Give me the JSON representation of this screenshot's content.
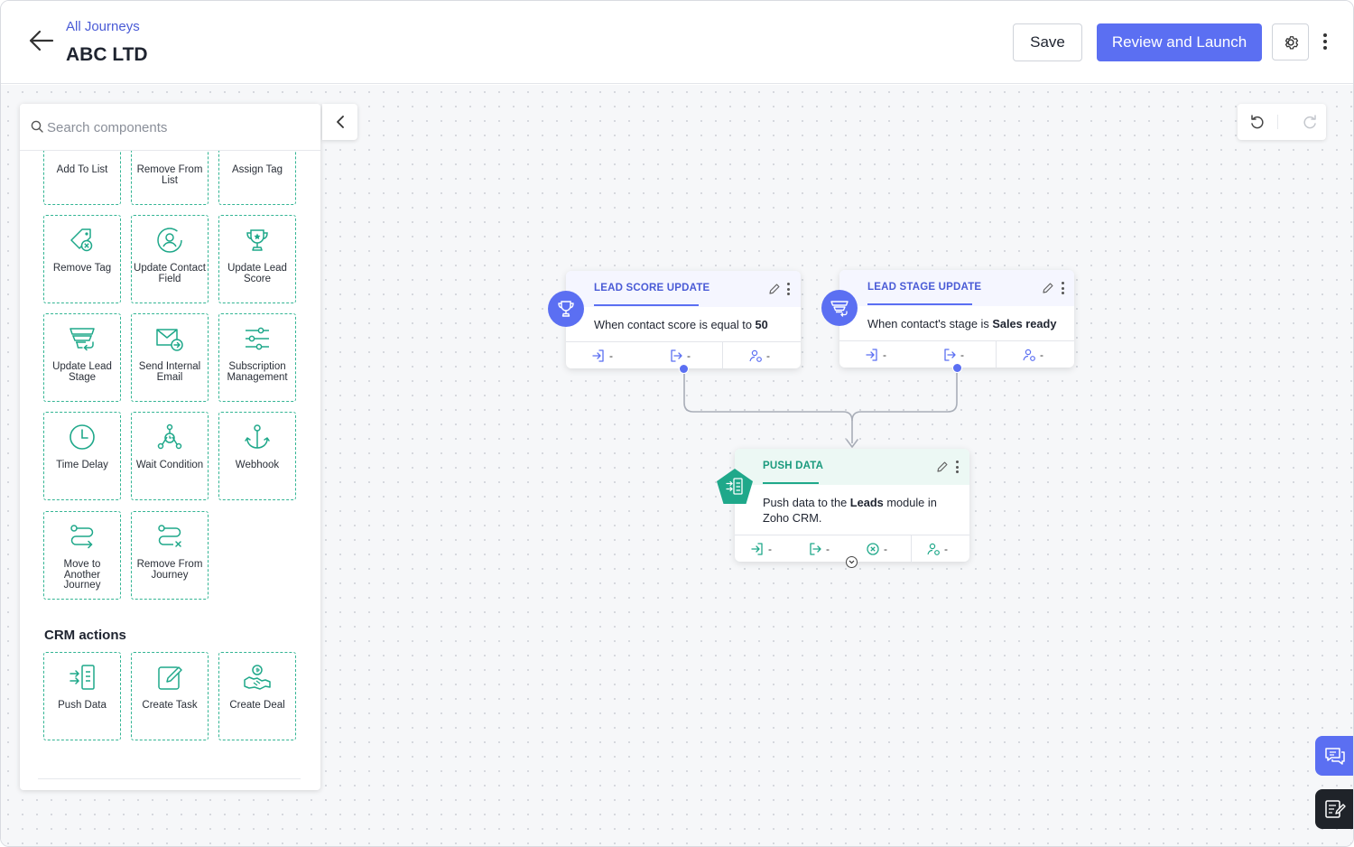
{
  "header": {
    "breadcrumb": "All Journeys",
    "title": "ABC LTD",
    "save_label": "Save",
    "launch_label": "Review and Launch"
  },
  "panel": {
    "search_placeholder": "Search components",
    "tiles": [
      {
        "label": "Add To List",
        "icon": "add-to-list-icon"
      },
      {
        "label": "Remove From List",
        "icon": "remove-from-list-icon"
      },
      {
        "label": "Assign Tag",
        "icon": "assign-tag-icon"
      },
      {
        "label": "Remove Tag",
        "icon": "remove-tag-icon"
      },
      {
        "label": "Update Contact Field",
        "icon": "update-contact-field-icon"
      },
      {
        "label": "Update Lead Score",
        "icon": "trophy-icon"
      },
      {
        "label": "Update Lead Stage",
        "icon": "funnel-icon"
      },
      {
        "label": "Send Internal Email",
        "icon": "envelope-icon"
      },
      {
        "label": "Subscription Management",
        "icon": "sliders-icon"
      },
      {
        "label": "Time Delay",
        "icon": "clock-icon"
      },
      {
        "label": "Wait Condition",
        "icon": "wait-condition-icon"
      },
      {
        "label": "Webhook",
        "icon": "anchor-icon"
      },
      {
        "label": "Move to Another Journey",
        "icon": "route-icon"
      },
      {
        "label": "Remove From Journey",
        "icon": "route-remove-icon"
      }
    ],
    "crm_section_title": "CRM actions",
    "crm_tiles": [
      {
        "label": "Push Data",
        "icon": "push-data-icon"
      },
      {
        "label": "Create Task",
        "icon": "create-task-icon"
      },
      {
        "label": "Create Deal",
        "icon": "handshake-icon"
      }
    ]
  },
  "nodes": {
    "lead_score": {
      "heading": "LEAD SCORE UPDATE",
      "desc_pre": "When contact score is equal to ",
      "desc_bold": "50",
      "stats": [
        "-",
        "-",
        "-"
      ]
    },
    "lead_stage": {
      "heading": "LEAD STAGE UPDATE",
      "desc_pre": "When contact's stage is ",
      "desc_bold": "Sales ready",
      "stats": [
        "-",
        "-",
        "-"
      ]
    },
    "push_data": {
      "heading": "PUSH DATA",
      "desc_pre": "Push data to the ",
      "desc_bold": "Leads",
      "desc_post": " module in Zoho CRM.",
      "stats": [
        "-",
        "-",
        "-",
        "-"
      ]
    }
  },
  "colors": {
    "accent": "#5b6ff2",
    "crm_green": "#1fa88a",
    "tile_border": "#33b594"
  }
}
